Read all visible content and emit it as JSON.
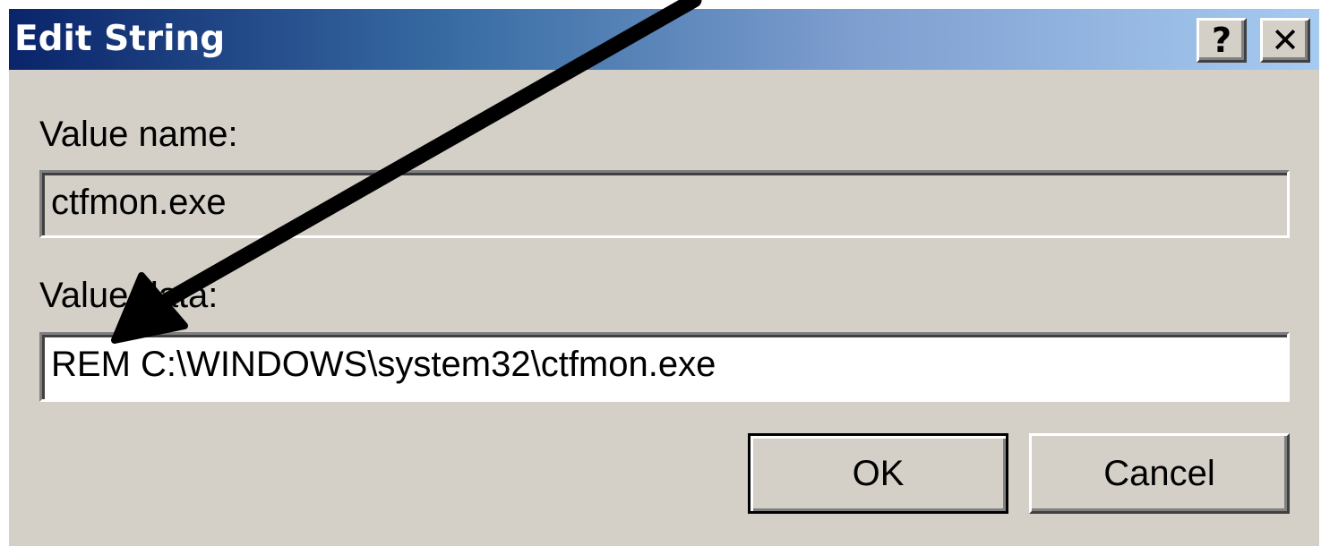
{
  "window": {
    "title": "Edit String",
    "help_button_label": "?",
    "close_button_label": "✕"
  },
  "value_name": {
    "label": "Value name:",
    "value": "ctfmon.exe"
  },
  "value_data": {
    "label": "Value data:",
    "value": "REM C:\\WINDOWS\\system32\\ctfmon.exe"
  },
  "buttons": {
    "ok_label": "OK",
    "cancel_label": "Cancel"
  },
  "colors": {
    "dialog_face": "#d4d0c8",
    "title_gradient_start": "#0a246a",
    "title_gradient_end": "#a6caf0",
    "annotation_arrow": "#000000"
  },
  "icons": {
    "help": "question-mark-icon",
    "close": "close-x-icon",
    "annotation": "arrow-icon"
  }
}
